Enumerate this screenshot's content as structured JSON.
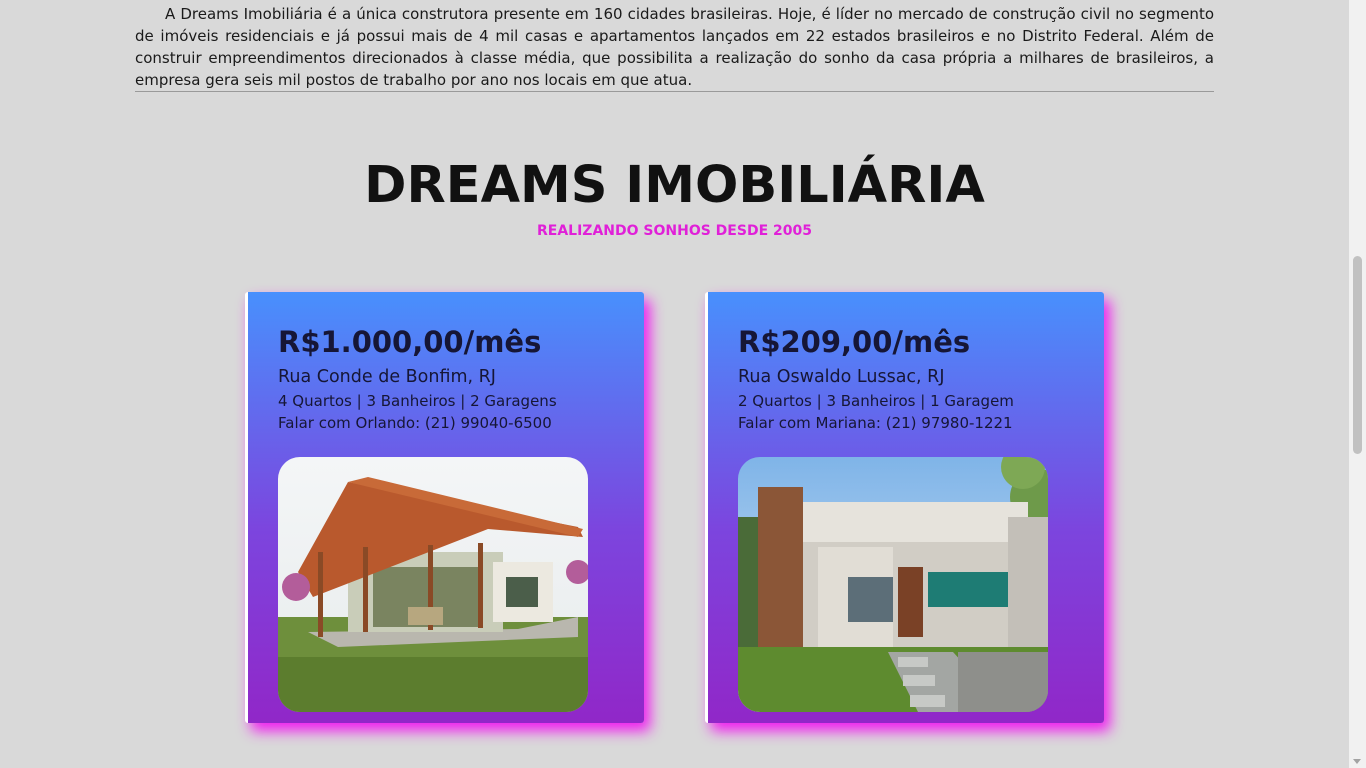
{
  "intro": "A Dreams Imobiliária é a única construtora presente em 160 cidades brasileiras. Hoje, é líder no mercado de construção civil no segmento de imóveis residenciais e já possui mais de 4 mil casas e apartamentos lançados em 22 estados brasileiros e no Distrito Federal. Além de construir empreendimentos direcionados à classe média, que possibilita a realização do sonho da casa própria a milhares de brasileiros, a empresa gera seis mil postos de trabalho por ano nos locais em que atua.",
  "hero": {
    "title": "DREAMS IMOBILIÁRIA",
    "subtitle": "REALIZANDO SONHOS DESDE 2005"
  },
  "colors": {
    "accent": "#e020d8",
    "card_gradient_top": "#4890fd",
    "card_gradient_bottom": "#9127c8",
    "page_bg": "#d9d9d9"
  },
  "listings": [
    {
      "price": "R$1.000,00/mês",
      "street": "Rua Conde de Bonfim, RJ",
      "rooms": "4 Quartos | 3 Banheiros | 2 Garagens",
      "contact": "Falar com Orlando: (21) 99040-6500",
      "image": "house-photo-tiled-roof"
    },
    {
      "price": "R$209,00/mês",
      "street": "Rua Oswaldo Lussac, RJ",
      "rooms": "2 Quartos | 3 Banheiros | 1 Garagem",
      "contact": "Falar com Mariana: (21) 97980-1221",
      "image": "house-photo-modern"
    }
  ]
}
